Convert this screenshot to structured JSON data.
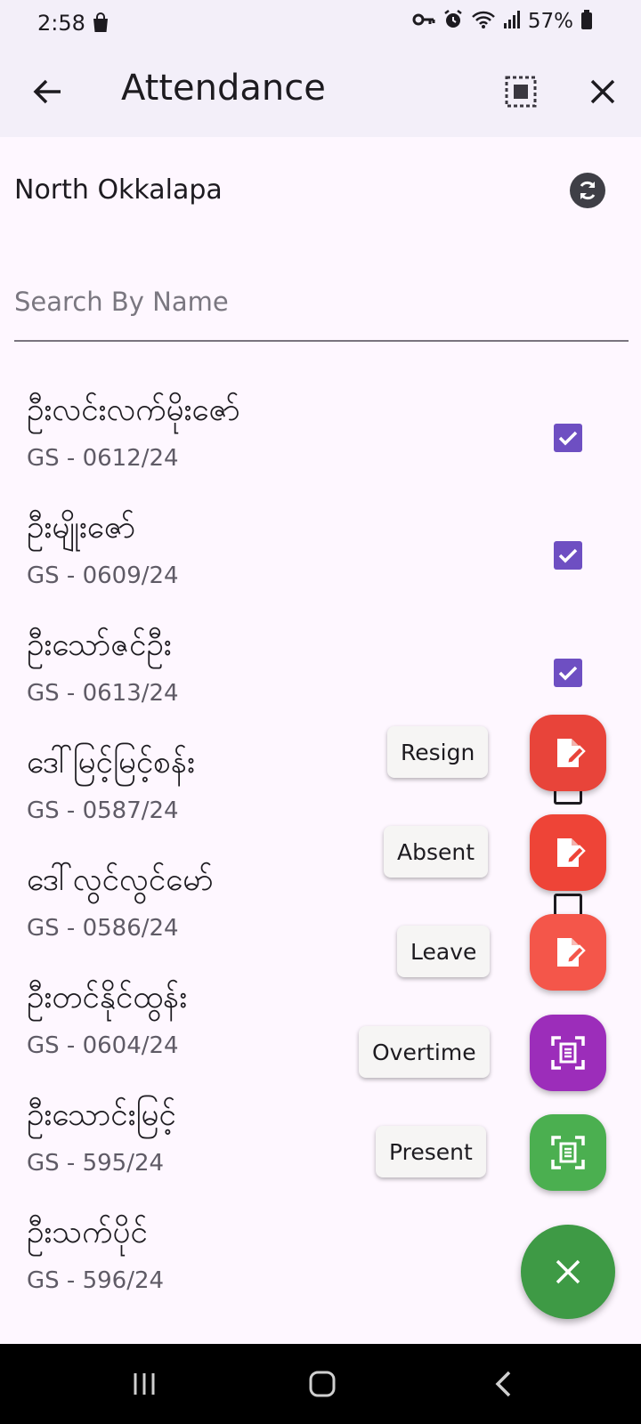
{
  "status_bar": {
    "time": "2:58",
    "battery": "57%"
  },
  "app_bar": {
    "title": "Attendance"
  },
  "location": {
    "name": "North Okkalapa"
  },
  "search": {
    "placeholder": "Search By Name",
    "value": ""
  },
  "employees": [
    {
      "name": "ဦးလင်းလက်မိုးဇော်",
      "code": "GS - 0612/24",
      "checked": true
    },
    {
      "name": "ဦးမျိုးဇော်",
      "code": "GS - 0609/24",
      "checked": true
    },
    {
      "name": "ဦးသော်ဇင်ဦး",
      "code": "GS - 0613/24",
      "checked": true
    },
    {
      "name": "ဒေါ်မြင့်မြင့်စန်း",
      "code": "GS - 0587/24",
      "checked": false
    },
    {
      "name": "ဒေါ်လွင်လွင်မော်",
      "code": "GS - 0586/24",
      "checked": false
    },
    {
      "name": "ဦးတင်နိုင်ထွန်း",
      "code": "GS - 0604/24",
      "checked": false
    },
    {
      "name": "ဦးသောင်းမြင့်",
      "code": "GS - 595/24",
      "checked": false
    },
    {
      "name": "ဦးသက်ပိုင်",
      "code": "GS - 596/24",
      "checked": false
    }
  ],
  "actions": [
    {
      "label": "Resign",
      "icon": "edit-note-icon",
      "color": "#E8443A"
    },
    {
      "label": "Absent",
      "icon": "edit-note-icon",
      "color": "#EE4437"
    },
    {
      "label": "Leave",
      "icon": "edit-note-icon",
      "color": "#F4564A"
    },
    {
      "label": "Overtime",
      "icon": "scan-document-icon",
      "color": "#9C2DBA"
    },
    {
      "label": "Present",
      "icon": "scan-document-icon",
      "color": "#4BAF50"
    }
  ],
  "fab": {
    "icon": "close-icon",
    "color": "#3E9A45"
  }
}
